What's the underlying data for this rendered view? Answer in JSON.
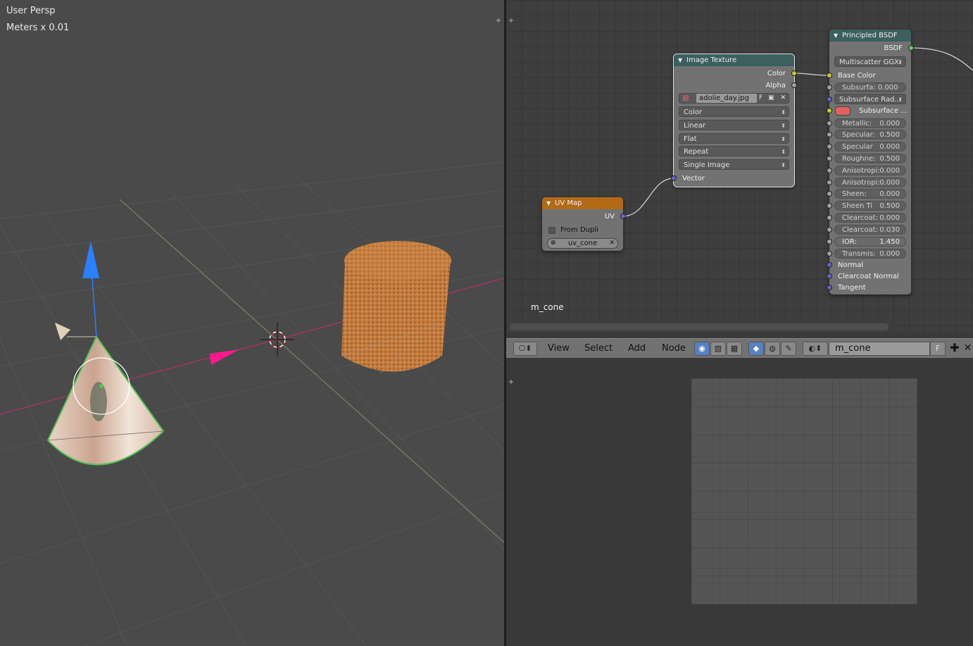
{
  "viewport": {
    "view_name": "User Persp",
    "units": "Meters x 0.01"
  },
  "colors": {
    "axis_x": "#ff1a8c",
    "axis_z": "#2a7fff",
    "node_header_texture": "#3c5f5f",
    "node_header_input": "#b26a17",
    "button_active": "#5680c2",
    "subsurface_color": "#e06060"
  },
  "nodes": {
    "principled": {
      "title": "Principled BSDF",
      "output": "BSDF",
      "distribution": "Multiscatter GGX",
      "base_color": "Base Color",
      "subsurface": {
        "label": "Subsurfa:",
        "value": "0.000"
      },
      "subsurface_radius": "Subsurface Rad...",
      "subsurface_color": "Subsurface ...",
      "metallic": {
        "label": "Metallic:",
        "value": "0.000"
      },
      "specular": {
        "label": "Specular:",
        "value": "0.500"
      },
      "specular_tint": {
        "label": "Specular",
        "value": "0.000"
      },
      "roughness": {
        "label": "Roughne:",
        "value": "0.500"
      },
      "anisotropic": {
        "label": "Anisotropi:",
        "value": "0.000"
      },
      "anisotropic_rot": {
        "label": "Anisotropi:",
        "value": "0.000"
      },
      "sheen": {
        "label": "Sheen:",
        "value": "0.000"
      },
      "sheen_tint": {
        "label": "Sheen Ti",
        "value": "0.500"
      },
      "clearcoat": {
        "label": "Clearcoat:",
        "value": "0.000"
      },
      "clearcoat_rough": {
        "label": "Clearcoat:",
        "value": "0.030"
      },
      "ior": {
        "label": "IOR:",
        "value": "1.450"
      },
      "transmission": {
        "label": "Transmis:",
        "value": "0.000"
      },
      "normal": "Normal",
      "clearcoat_normal": "Clearcoat Normal",
      "tangent": "Tangent"
    },
    "image_texture": {
      "title": "Image Texture",
      "out_color": "Color",
      "out_alpha": "Alpha",
      "image_name": "adolie_day.jpg",
      "fake_user": "F",
      "color_space": "Color",
      "interpolation": "Linear",
      "projection": "Flat",
      "extension": "Repeat",
      "source": "Single Image",
      "in_vector": "Vector"
    },
    "uv_map": {
      "title": "UV Map",
      "out_uv": "UV",
      "from_dupli": "From Dupli",
      "uv_name": "uv_cone"
    }
  },
  "node_editor": {
    "material_label": "m_cone"
  },
  "header": {
    "menus": [
      "View",
      "Select",
      "Add",
      "Node"
    ],
    "material_name": "m_cone",
    "fake_user": "F"
  }
}
